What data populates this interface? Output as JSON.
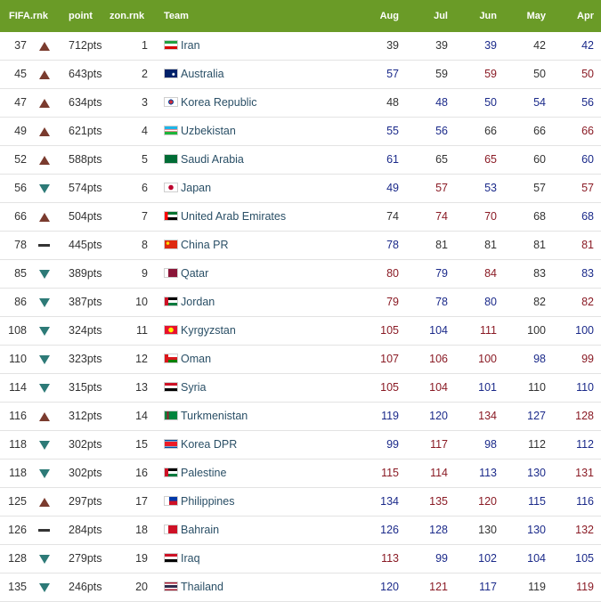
{
  "header": {
    "fifa_rank": "FIFA.rnk",
    "points": "point",
    "zone_rank": "zon.rnk",
    "team": "Team",
    "months": [
      "Aug",
      "Jul",
      "Jun",
      "May",
      "Apr"
    ]
  },
  "colors": {
    "header_bg": "#6a9b27",
    "trend_up": "#7a3b2e",
    "trend_down": "#2d7a77",
    "value_better": "#1b2a8a",
    "value_worse": "#8a1b25"
  },
  "rows": [
    {
      "fifa": "37",
      "trend": "up",
      "points": "712pts",
      "zone": "1",
      "team": "Iran",
      "flag": "iran-flag-icon",
      "history": [
        "39",
        "39",
        "39",
        "42",
        "42"
      ]
    },
    {
      "fifa": "45",
      "trend": "up",
      "points": "643pts",
      "zone": "2",
      "team": "Australia",
      "flag": "australia-flag-icon",
      "history": [
        "57",
        "59",
        "59",
        "50",
        "50"
      ]
    },
    {
      "fifa": "47",
      "trend": "up",
      "points": "634pts",
      "zone": "3",
      "team": "Korea Republic",
      "flag": "korea-republic-flag-icon",
      "history": [
        "48",
        "48",
        "50",
        "54",
        "56"
      ]
    },
    {
      "fifa": "49",
      "trend": "up",
      "points": "621pts",
      "zone": "4",
      "team": "Uzbekistan",
      "flag": "uzbekistan-flag-icon",
      "history": [
        "55",
        "56",
        "66",
        "66",
        "66"
      ]
    },
    {
      "fifa": "52",
      "trend": "up",
      "points": "588pts",
      "zone": "5",
      "team": "Saudi Arabia",
      "flag": "saudi-arabia-flag-icon",
      "history": [
        "61",
        "65",
        "65",
        "60",
        "60"
      ]
    },
    {
      "fifa": "56",
      "trend": "down",
      "points": "574pts",
      "zone": "6",
      "team": "Japan",
      "flag": "japan-flag-icon",
      "history": [
        "49",
        "57",
        "53",
        "57",
        "57"
      ]
    },
    {
      "fifa": "66",
      "trend": "up",
      "points": "504pts",
      "zone": "7",
      "team": "United Arab Emirates",
      "flag": "uae-flag-icon",
      "history": [
        "74",
        "74",
        "70",
        "68",
        "68"
      ]
    },
    {
      "fifa": "78",
      "trend": "same",
      "points": "445pts",
      "zone": "8",
      "team": "China PR",
      "flag": "china-flag-icon",
      "history": [
        "78",
        "81",
        "81",
        "81",
        "81"
      ]
    },
    {
      "fifa": "85",
      "trend": "down",
      "points": "389pts",
      "zone": "9",
      "team": "Qatar",
      "flag": "qatar-flag-icon",
      "history": [
        "80",
        "79",
        "84",
        "83",
        "83"
      ]
    },
    {
      "fifa": "86",
      "trend": "down",
      "points": "387pts",
      "zone": "10",
      "team": "Jordan",
      "flag": "jordan-flag-icon",
      "history": [
        "79",
        "78",
        "80",
        "82",
        "82"
      ]
    },
    {
      "fifa": "108",
      "trend": "down",
      "points": "324pts",
      "zone": "11",
      "team": "Kyrgyzstan",
      "flag": "kyrgyzstan-flag-icon",
      "history": [
        "105",
        "104",
        "111",
        "100",
        "100"
      ]
    },
    {
      "fifa": "110",
      "trend": "down",
      "points": "323pts",
      "zone": "12",
      "team": "Oman",
      "flag": "oman-flag-icon",
      "history": [
        "107",
        "106",
        "100",
        "98",
        "99"
      ]
    },
    {
      "fifa": "114",
      "trend": "down",
      "points": "315pts",
      "zone": "13",
      "team": "Syria",
      "flag": "syria-flag-icon",
      "history": [
        "105",
        "104",
        "101",
        "110",
        "110"
      ]
    },
    {
      "fifa": "116",
      "trend": "up",
      "points": "312pts",
      "zone": "14",
      "team": "Turkmenistan",
      "flag": "turkmenistan-flag-icon",
      "history": [
        "119",
        "120",
        "134",
        "127",
        "128"
      ]
    },
    {
      "fifa": "118",
      "trend": "down",
      "points": "302pts",
      "zone": "15",
      "team": "Korea DPR",
      "flag": "korea-dpr-flag-icon",
      "history": [
        "99",
        "117",
        "98",
        "112",
        "112"
      ]
    },
    {
      "fifa": "118",
      "trend": "down",
      "points": "302pts",
      "zone": "16",
      "team": "Palestine",
      "flag": "palestine-flag-icon",
      "history": [
        "115",
        "114",
        "113",
        "130",
        "131"
      ]
    },
    {
      "fifa": "125",
      "trend": "up",
      "points": "297pts",
      "zone": "17",
      "team": "Philippines",
      "flag": "philippines-flag-icon",
      "history": [
        "134",
        "135",
        "120",
        "115",
        "116"
      ]
    },
    {
      "fifa": "126",
      "trend": "same",
      "points": "284pts",
      "zone": "18",
      "team": "Bahrain",
      "flag": "bahrain-flag-icon",
      "history": [
        "126",
        "128",
        "130",
        "130",
        "132"
      ]
    },
    {
      "fifa": "128",
      "trend": "down",
      "points": "279pts",
      "zone": "19",
      "team": "Iraq",
      "flag": "iraq-flag-icon",
      "history": [
        "113",
        "99",
        "102",
        "104",
        "105"
      ]
    },
    {
      "fifa": "135",
      "trend": "down",
      "points": "246pts",
      "zone": "20",
      "team": "Thailand",
      "flag": "thailand-flag-icon",
      "history": [
        "120",
        "121",
        "117",
        "119",
        "119"
      ]
    }
  ]
}
